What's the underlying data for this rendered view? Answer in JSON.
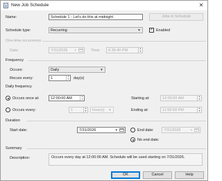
{
  "window": {
    "title": "New Job Schedule",
    "close_glyph": "✕"
  },
  "general": {
    "name_label": "Name:",
    "name_value": "Schedule 1 - Let's do this at midnight",
    "jobs_button": "Jobs in Schedule",
    "schedule_type_label": "Schedule type:",
    "schedule_type_value": "Recurring",
    "enabled_label": "Enabled",
    "enabled_checked": true
  },
  "one_time": {
    "section_label": "One-time occurrence",
    "date_label": "Date:",
    "date_value": "7/31/2026",
    "time_label": "Time:",
    "time_value": "6:39:40 PM"
  },
  "frequency": {
    "section_label": "Frequency",
    "occurs_label": "Occurs:",
    "occurs_value": "Daily",
    "recurs_label": "Recurs every:",
    "recurs_value": "1",
    "recurs_unit": "day(s)"
  },
  "daily": {
    "section_label": "Daily frequency",
    "once_label": "Occurs once at:",
    "once_value": "12:00:00 AM",
    "every_label": "Occurs every:",
    "every_value": "1",
    "every_unit": "hour(s)",
    "starting_label": "Starting at:",
    "starting_value": "12:00:00 AM",
    "ending_label": "Ending at:",
    "ending_value": "11:59:59 PM"
  },
  "duration": {
    "section_label": "Duration",
    "start_label": "Start date:",
    "start_value": "7/31/2026",
    "end_label": "End date:",
    "end_value": "7/31/2026",
    "no_end_label": "No end date:"
  },
  "summary": {
    "section_label": "Summary",
    "description_label": "Description:",
    "description_value": "Occurs every day at 12:00:00 AM. Schedule will be used starting on 7/31/2026."
  },
  "buttons": {
    "ok": "OK",
    "cancel": "Cancel",
    "help": "Help"
  }
}
